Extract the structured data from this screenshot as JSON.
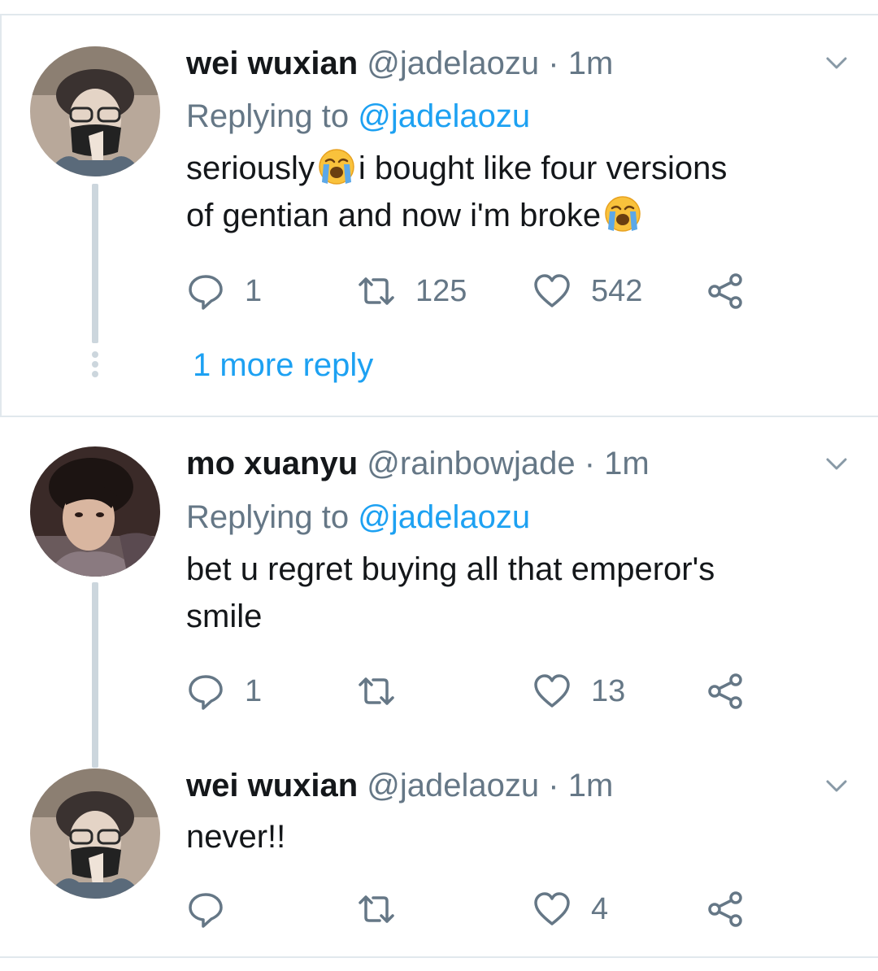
{
  "tweets": [
    {
      "name": "wei wuxian",
      "handle": "@jadelaozu",
      "separator": "·",
      "time": "1m",
      "replying_prefix": "Replying to",
      "replying_to": "@jadelaozu",
      "line1a": "seriously",
      "line1b": "i bought like four versions",
      "line2a": "of gentian and now i'm broke",
      "emoji": "loudly-crying-face",
      "replies": "1",
      "retweets": "125",
      "likes": "542",
      "more_replies": "1 more reply"
    },
    {
      "name": "mo xuanyu",
      "handle": "@rainbowjade",
      "separator": "·",
      "time": "1m",
      "replying_prefix": "Replying to",
      "replying_to": "@jadelaozu",
      "line1": "bet u regret buying all that emperor's",
      "line2": "smile",
      "replies": "1",
      "retweets": "",
      "likes": "13"
    },
    {
      "name": "wei wuxian",
      "handle": "@jadelaozu",
      "separator": "·",
      "time": "1m",
      "line1": "never!!",
      "replies": "",
      "retweets": "",
      "likes": "4"
    }
  ],
  "colors": {
    "accent": "#1da1f2",
    "muted": "#657786",
    "text": "#14171a",
    "divider": "#e1e8ed",
    "thread": "#ccd6dd"
  },
  "icons": [
    "reply-icon",
    "retweet-icon",
    "like-icon",
    "share-icon",
    "chevron-down-icon"
  ]
}
